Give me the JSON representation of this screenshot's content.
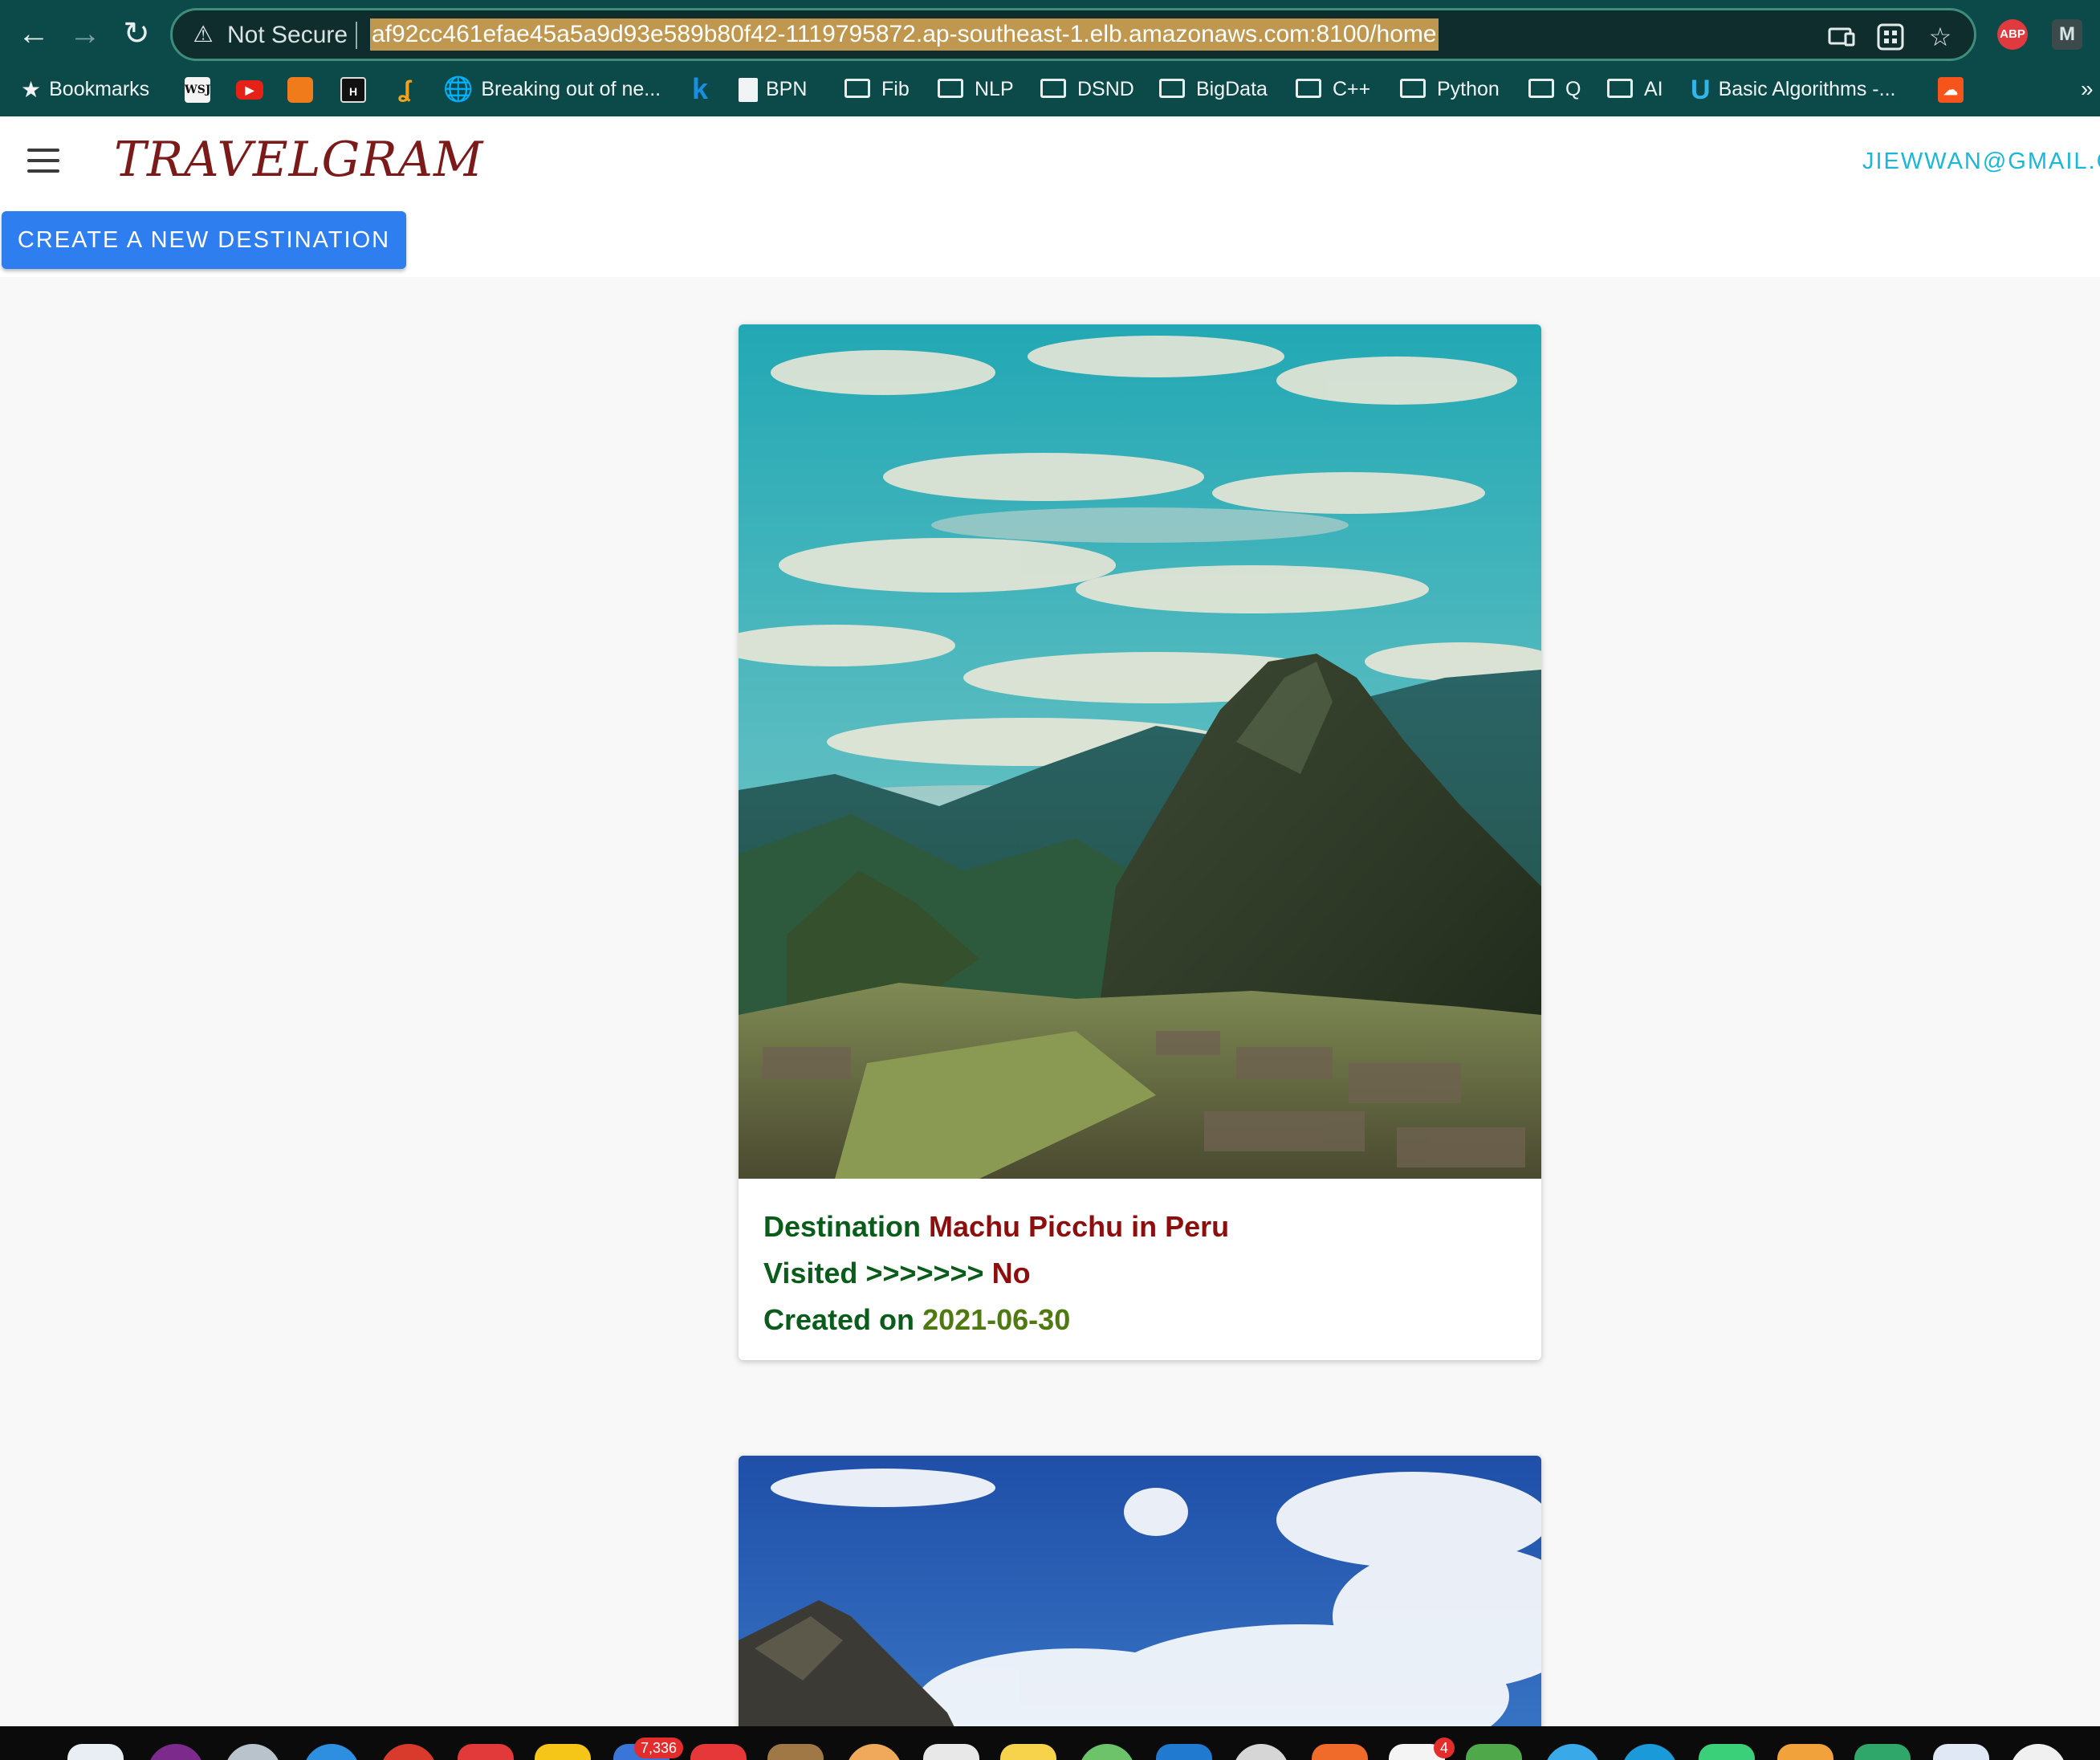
{
  "browser": {
    "security_label": "Not Secure",
    "url": "af92cc461efae45a5a9d93e589b80f42-1119795872.ap-southeast-1.elb.amazonaws.com:8100/home",
    "extensions": {
      "abp": "ABP",
      "m": "M"
    },
    "overflow": "»",
    "bookmarks": {
      "bookmarks_label": "Bookmarks",
      "wsj": "WSJ",
      "hn": "H",
      "breaking": "Breaking out of ne...",
      "k": "k",
      "bpn": "BPN",
      "fib": "Fib",
      "nlp": "NLP",
      "dsnd": "DSND",
      "bigdata": "BigData",
      "cpp": "C++",
      "python": "Python",
      "q": "Q",
      "ai": "AI",
      "basic_algorithms": "Basic Algorithms -..."
    }
  },
  "app": {
    "brand": "TRAVELGRAM",
    "account": "JIEWWAN@GMAIL.C",
    "create_button": "CREATE A NEW DESTINATION"
  },
  "destinations": [
    {
      "destination_label": "Destination",
      "name": "Machu Picchu",
      "in_label": "in",
      "country": "Peru",
      "visited_label": "Visited >>>>>>>",
      "visited": "No",
      "created_label": "Created on",
      "created": "2021-06-30"
    }
  ],
  "dock": {
    "badge_mail": "7,336",
    "badge_other": "4"
  },
  "colors": {
    "chrome": "#0b4a48",
    "brand": "#7c1a1a",
    "account": "#1ab8d8",
    "primary_button": "#2f7ef0",
    "label_green": "#0a5c1a",
    "value_red": "#8e0d0d",
    "date_olive": "#4f7a10"
  }
}
